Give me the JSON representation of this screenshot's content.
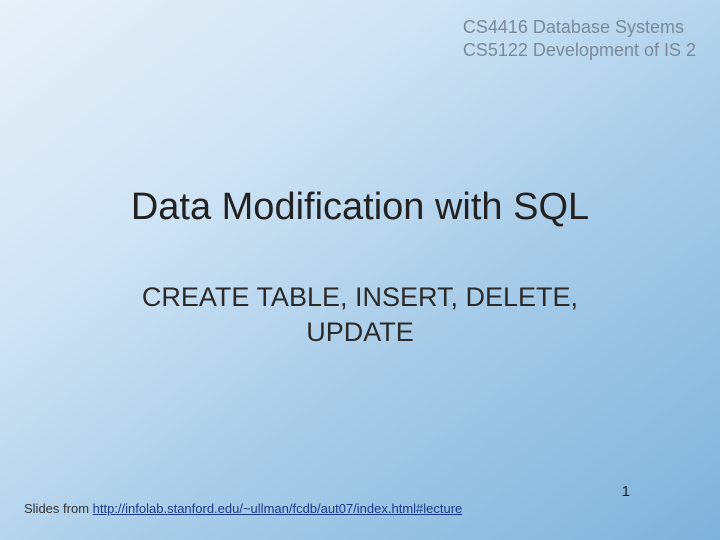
{
  "header": {
    "course1": "CS4416 Database Systems",
    "course2": "CS5122 Development of IS 2"
  },
  "main": {
    "title": "Data Modification with SQL",
    "subtitle_line1": "CREATE TABLE, INSERT, DELETE,",
    "subtitle_line2": "UPDATE"
  },
  "footer": {
    "credit_prefix": "Slides from ",
    "credit_link": "http://infolab.stanford.edu/~ullman/fcdb/aut07/index.html#lecture",
    "page_number": "1"
  }
}
